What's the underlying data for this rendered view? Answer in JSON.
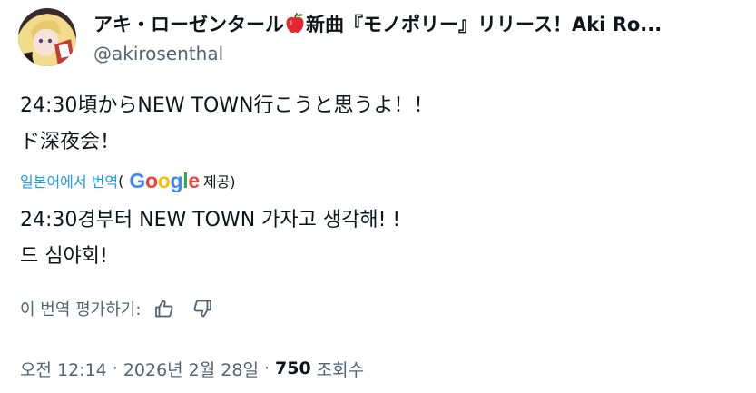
{
  "author": {
    "display_name_before_emoji": "アキ・ローゼンタール",
    "emoji_icon": "red-apple-icon",
    "display_name_after_emoji": "新曲『モノポリー』リリース！Aki Ro...",
    "handle": "@akirosenthal"
  },
  "tweet": {
    "original_lines": [
      "24:30頃からNEW TOWN行こうと思うよ！！",
      "ド深夜会！"
    ],
    "translate_label": "일본어에서 번역",
    "provider_open": "(",
    "provider_logo_letters": [
      "G",
      "o",
      "o",
      "g",
      "l",
      "e"
    ],
    "provider_suffix": "제공)",
    "translated_lines": [
      "24:30경부터 NEW TOWN 가자고 생각해! !",
      "드 심야회!"
    ]
  },
  "rating": {
    "label": "이 번역 평가하기:",
    "up_icon": "thumbs-up-icon",
    "down_icon": "thumbs-down-icon"
  },
  "meta": {
    "time": "오전 12:14",
    "separator": "·",
    "date": "2026년 2월 28일",
    "views_number": "750",
    "views_label": "조회수"
  },
  "colors": {
    "link": "#1d9bf0",
    "secondary_text": "#536471",
    "primary_text": "#0f1419",
    "google_blue": "#4285f4",
    "google_red": "#ea4335",
    "google_yellow": "#fbbc05",
    "google_green": "#34a853"
  }
}
